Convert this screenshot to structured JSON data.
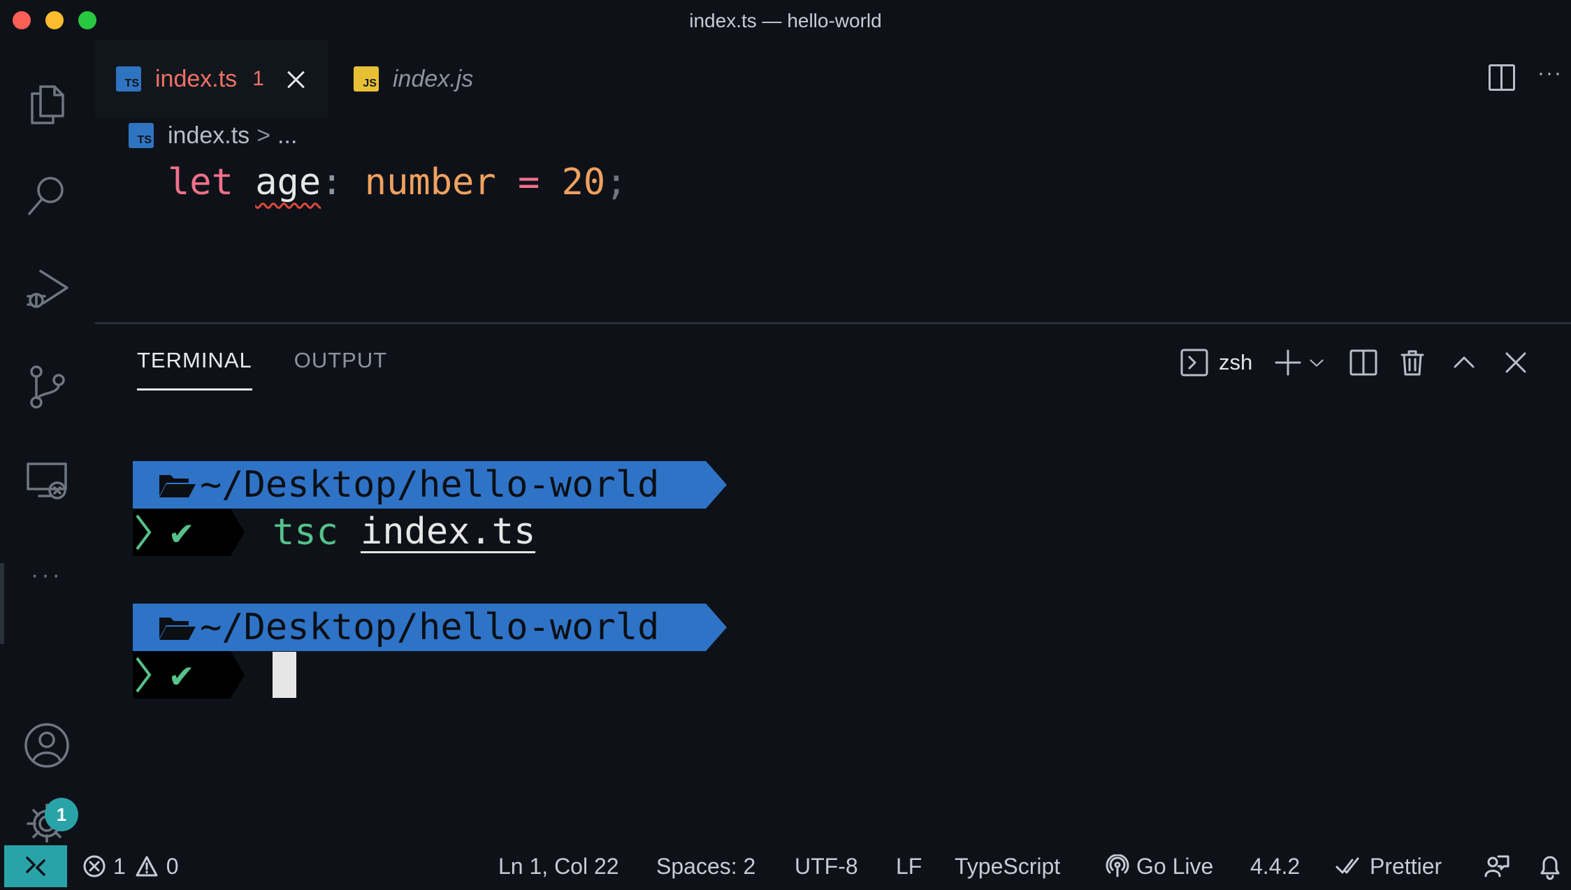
{
  "window": {
    "title": "index.ts — hello-world"
  },
  "activity_bar": {
    "items": [
      "explorer-icon",
      "search-icon",
      "run-debug-icon",
      "source-control-icon",
      "remote-explorer-icon",
      "more-icon",
      "accounts-icon",
      "manage-gear-icon"
    ],
    "more_label": "···",
    "settings_badge": "1"
  },
  "tabs": [
    {
      "label": "index.ts",
      "badge": "TS",
      "problems": "1",
      "active": true
    },
    {
      "label": "index.js",
      "badge": "JS",
      "active": false
    }
  ],
  "breadcrumb": {
    "badge": "TS",
    "file": "index.ts",
    "separator": ">",
    "more": "..."
  },
  "editor": {
    "code": {
      "kw": "let",
      "var": "age",
      "colon": ":",
      "type": "number",
      "op": "=",
      "num": "20",
      "semi": ";"
    }
  },
  "panel": {
    "tabs": [
      "TERMINAL",
      "OUTPUT"
    ],
    "shell": "zsh"
  },
  "terminal": {
    "path": "~/Desktop/hello-world",
    "command": "tsc",
    "arg": "index.ts",
    "check": "✔"
  },
  "status": {
    "errors": "1",
    "warnings": "0",
    "position": "Ln 1, Col 22",
    "spaces": "Spaces: 2",
    "encoding": "UTF-8",
    "eol": "LF",
    "language": "TypeScript",
    "golive": "Go Live",
    "version": "4.4.2",
    "prettier": "Prettier"
  },
  "colors": {
    "accent": "#2aa3a8",
    "prompt_blue": "#2f73c7",
    "error": "#f07264"
  }
}
